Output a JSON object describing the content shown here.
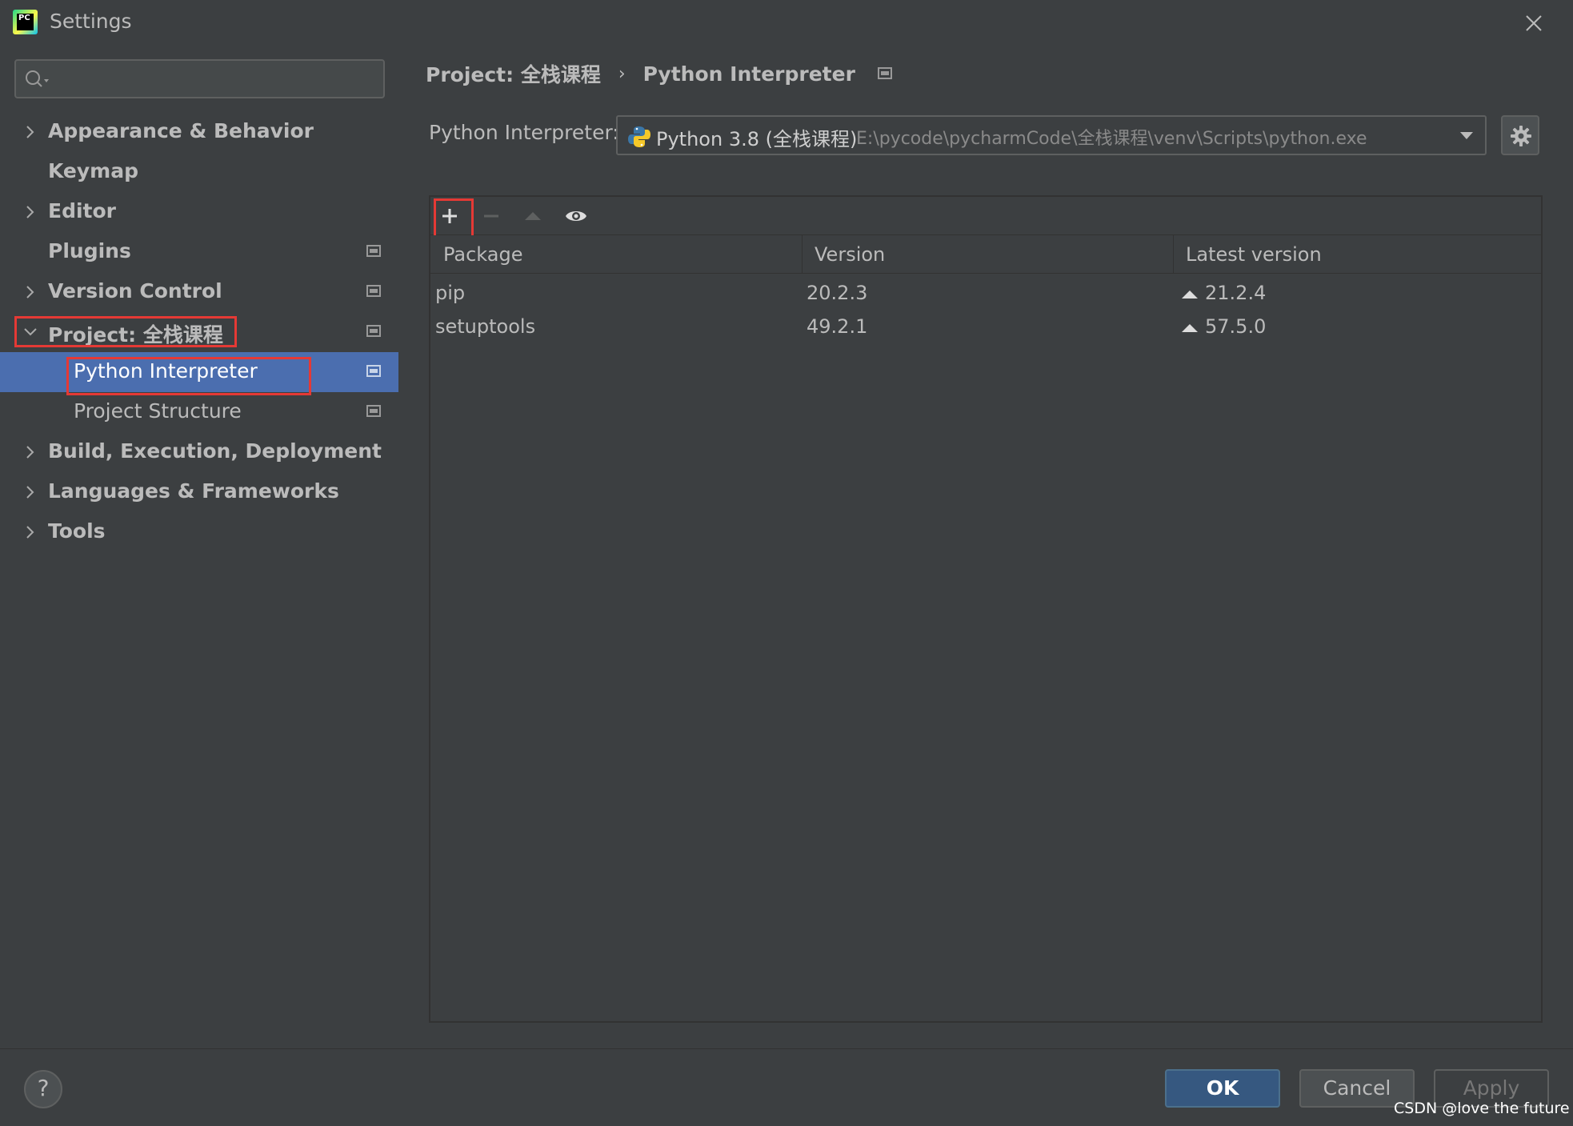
{
  "window": {
    "title": "Settings",
    "app_icon_text": "PC"
  },
  "sidebar": {
    "search_placeholder": "",
    "items": [
      {
        "label": "Appearance & Behavior"
      },
      {
        "label": "Keymap"
      },
      {
        "label": "Editor"
      },
      {
        "label": "Plugins"
      },
      {
        "label": "Version Control"
      },
      {
        "label": "Project: 全栈课程"
      },
      {
        "label": "Python Interpreter"
      },
      {
        "label": "Project Structure"
      },
      {
        "label": "Build, Execution, Deployment"
      },
      {
        "label": "Languages & Frameworks"
      },
      {
        "label": "Tools"
      }
    ]
  },
  "breadcrumb": {
    "project": "Project: 全栈课程",
    "separator": "›",
    "page": "Python Interpreter"
  },
  "interpreter": {
    "label": "Python Interpreter:",
    "name": "Python 3.8 (全栈课程)",
    "path": "E:\\pycode\\pycharmCode\\全栈课程\\venv\\Scripts\\python.exe"
  },
  "packages": {
    "columns": [
      "Package",
      "Version",
      "Latest version"
    ],
    "rows": [
      {
        "package": "pip",
        "version": "20.2.3",
        "latest": "21.2.4"
      },
      {
        "package": "setuptools",
        "version": "49.2.1",
        "latest": "57.5.0"
      }
    ]
  },
  "footer": {
    "help_label": "?",
    "ok_label": "OK",
    "cancel_label": "Cancel",
    "apply_label": "Apply"
  },
  "watermark": "CSDN @love the future",
  "colors": {
    "background": "#3c3f41",
    "selection": "#4b6eaf",
    "highlight_box": "#e53935",
    "ok_button": "#365880"
  }
}
